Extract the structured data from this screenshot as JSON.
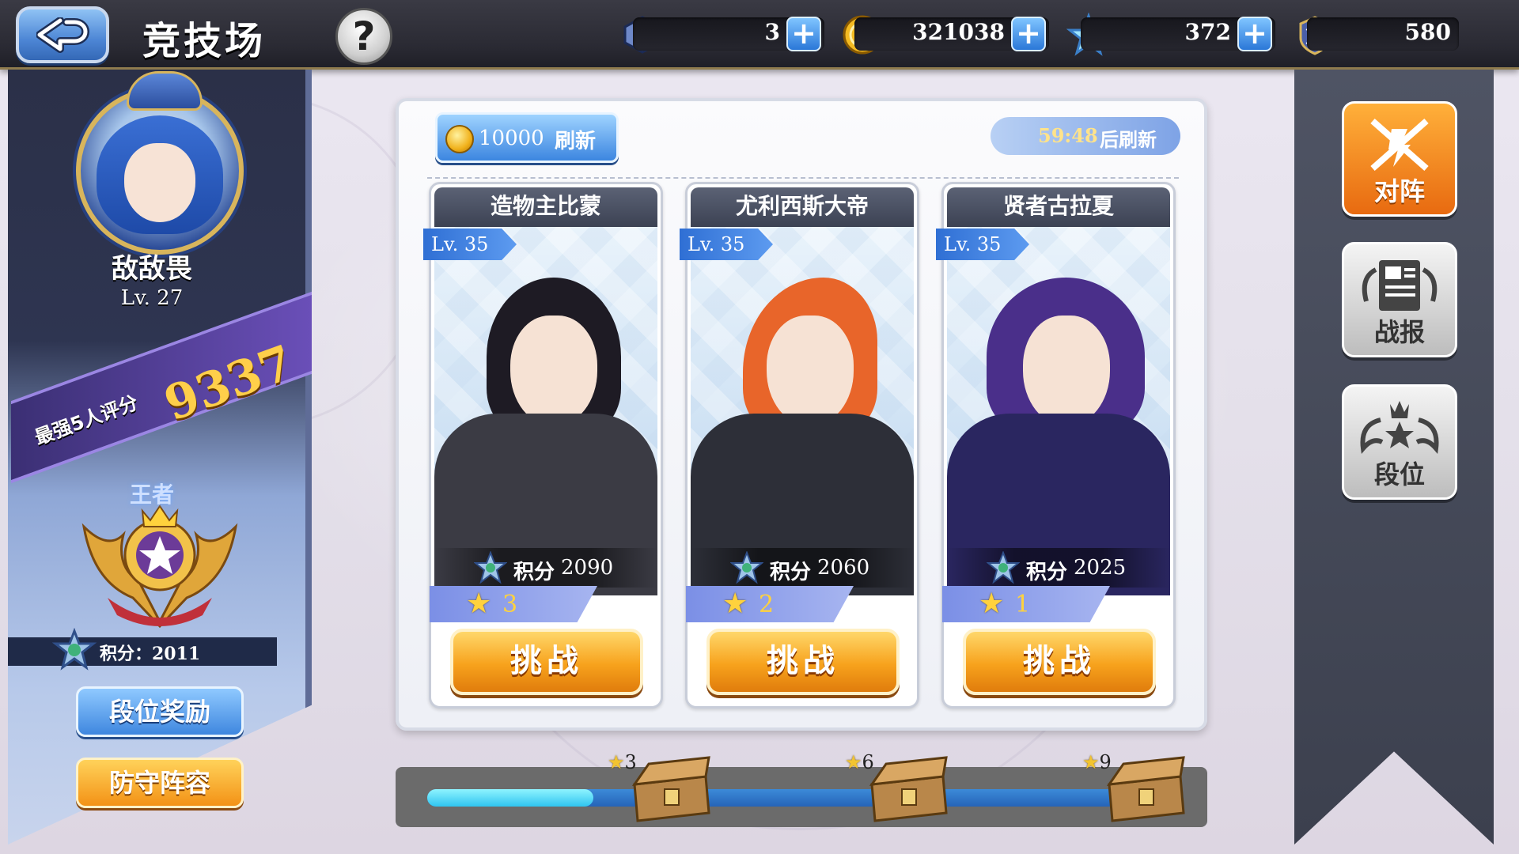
{
  "header": {
    "title": "竞技场",
    "help_label": "?",
    "resources": [
      {
        "icon": "ticket-icon",
        "value": "3"
      },
      {
        "icon": "gold-coin-icon",
        "value": "321038"
      },
      {
        "icon": "crystal-star-icon",
        "value": "372"
      },
      {
        "icon": "arena-medal-icon",
        "value": "580"
      }
    ]
  },
  "player": {
    "name": "敌敌畏",
    "level": "Lv. 27",
    "score_label": "最强5人评分",
    "score_value": "9337",
    "rank_title": "王者",
    "points_label": "积分：2011",
    "buttons": {
      "rank_rewards": "段位奖励",
      "defense_lineup": "防守阵容"
    }
  },
  "refresh": {
    "cost": "10000",
    "label": "刷新",
    "timer": "59:48",
    "timer_suffix": "后刷新"
  },
  "opponents": [
    {
      "name": "造物主比蒙",
      "level": "Lv. 35",
      "points_label": "积分",
      "points": "2090",
      "stars": "3",
      "challenge": "挑战",
      "hair_color": "#1e1b24",
      "outfit_color": "#3b3b44"
    },
    {
      "name": "尤利西斯大帝",
      "level": "Lv. 35",
      "points_label": "积分",
      "points": "2060",
      "stars": "2",
      "challenge": "挑战",
      "hair_color": "#e8652a",
      "outfit_color": "#2d2f38"
    },
    {
      "name": "贤者古拉夏",
      "level": "Lv. 35",
      "points_label": "积分",
      "points": "2025",
      "stars": "1",
      "challenge": "挑战",
      "hair_color": "#4a2f8a",
      "outfit_color": "#2a2660"
    }
  ],
  "progress": {
    "fraction": 0.22,
    "chests": [
      {
        "stars": "3"
      },
      {
        "stars": "6"
      },
      {
        "stars": "9"
      }
    ]
  },
  "side_menu": {
    "battle": "对阵",
    "report": "战报",
    "rank": "段位"
  },
  "colors": {
    "accent_orange": "#f39216",
    "accent_blue": "#3c86e0",
    "gold": "#ffcf4a"
  }
}
